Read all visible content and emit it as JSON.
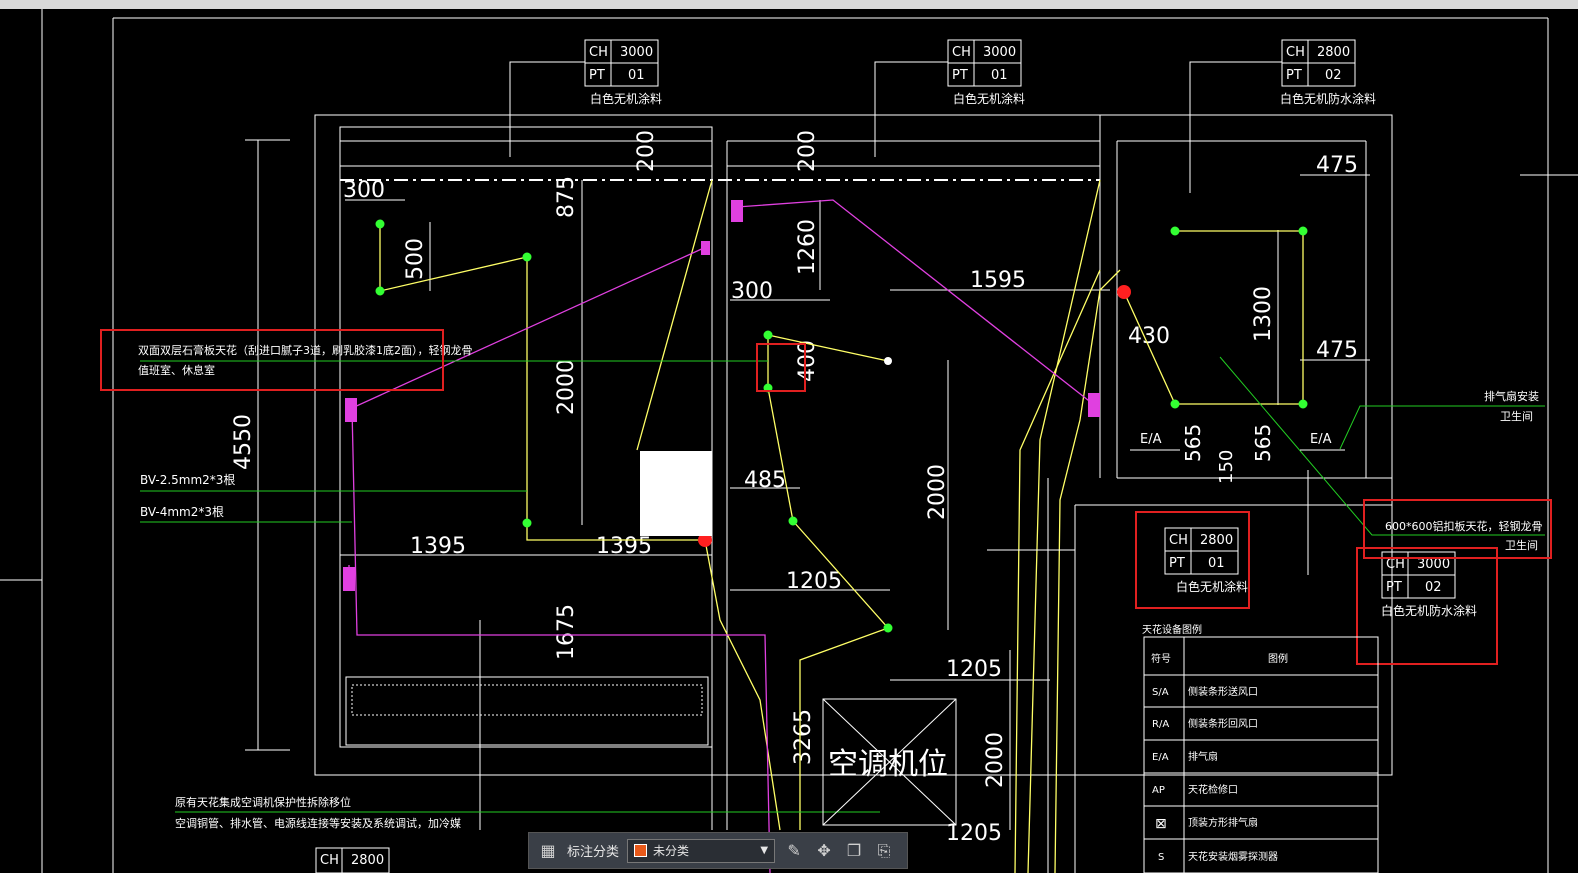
{
  "tags": [
    {
      "ch_label": "CH",
      "ch_value": "3000",
      "pt_label": "PT",
      "pt_value": "01",
      "caption": "白色无机涂料"
    },
    {
      "ch_label": "CH",
      "ch_value": "3000",
      "pt_label": "PT",
      "pt_value": "01",
      "caption": "白色无机涂料"
    },
    {
      "ch_label": "CH",
      "ch_value": "2800",
      "pt_label": "PT",
      "pt_value": "02",
      "caption": "白色无机防水涂料"
    },
    {
      "ch_label": "CH",
      "ch_value": "2800",
      "pt_label": "PT",
      "pt_value": "01",
      "caption": "白色无机涂料"
    },
    {
      "ch_label": "CH",
      "ch_value": "3000",
      "pt_label": "PT",
      "pt_value": "02",
      "caption": "白色无机防水涂料"
    },
    {
      "ch_label": "CH",
      "ch_value": "2800"
    }
  ],
  "dims": [
    "300",
    "500",
    "875",
    "200",
    "200",
    "1260",
    "300",
    "400",
    "2000",
    "4550",
    "1595",
    "430",
    "475",
    "1300",
    "475",
    "485",
    "1395",
    "1395",
    "2000",
    "1205",
    "1675",
    "1205",
    "3265",
    "2000",
    "1205",
    "565",
    "565",
    "150"
  ],
  "notes": {
    "ceiling_note_1": "双面双层石膏板天花（刮进口腻子3道，刷乳胶漆1底2面），轻钢龙骨",
    "ceiling_note_2": "值班室、休息室",
    "wire_1": "BV-2.5mm2*3根",
    "wire_2": "BV-4mm2*3根",
    "fan_note_1": "排气扇安装",
    "fan_note_2": "卫生间",
    "alu_note_1": "600*600铝扣板天花，轻钢龙骨",
    "alu_note_2": "卫生间",
    "bottom_note_1": "原有天花集成空调机保护性拆除移位",
    "bottom_note_2": "空调铜管、排水管、电源线连接等安装及系统调试，加冷媒",
    "ac_label": "空调机位",
    "ea_1": "E/A",
    "ea_2": "E/A"
  },
  "legend": {
    "title": "天花设备图例",
    "header_symbol": "符号",
    "header_desc": "图例",
    "rows": [
      {
        "symbol": "S/A",
        "desc": "侧装条形送风口"
      },
      {
        "symbol": "R/A",
        "desc": "侧装条形回风口"
      },
      {
        "symbol": "E/A",
        "desc": "排气扇"
      },
      {
        "symbol": "AP",
        "desc": "天花检修口"
      },
      {
        "symbol": "⊠",
        "desc": "顶装方形排气扇"
      },
      {
        "symbol": "S",
        "desc": "天花安装烟雾探测器"
      }
    ]
  },
  "toolbar": {
    "label": "标注分类",
    "selected": "未分类",
    "accent": "#e8591a"
  },
  "colors": {
    "annotation_box": "#e02020",
    "wire_yellow": "#ffff66",
    "wire_magenta": "#e040e0",
    "node_green": "#33ff33",
    "leader_green": "#22cc22"
  }
}
